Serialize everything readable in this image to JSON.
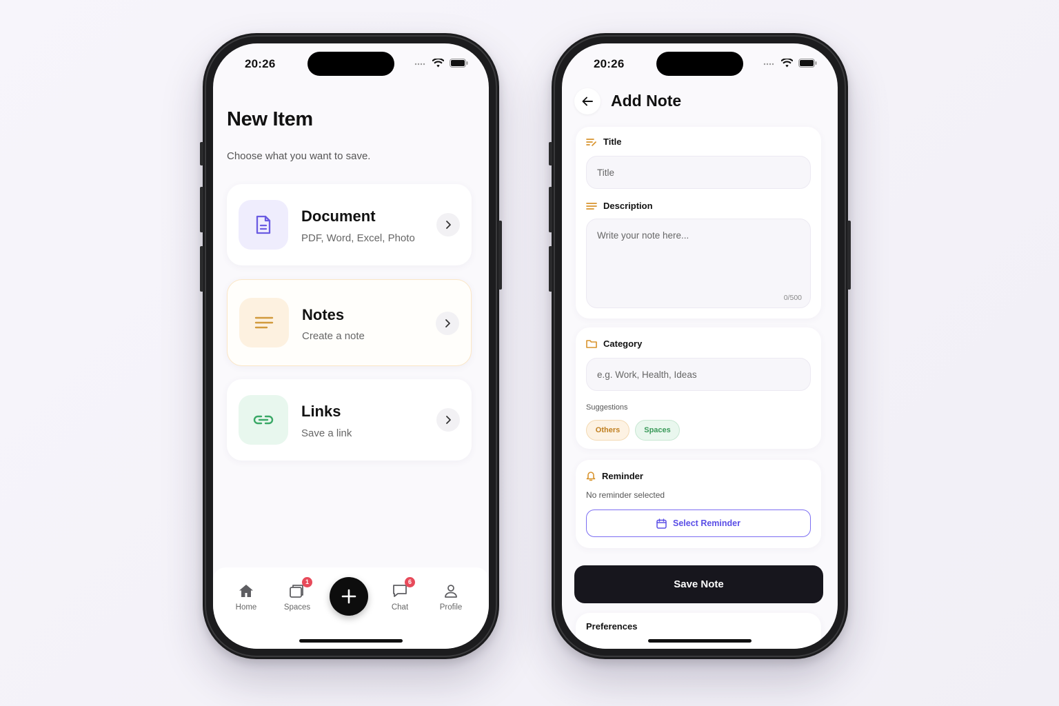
{
  "left_phone": {
    "status": {
      "time": "20:26"
    },
    "title": "New Item",
    "subtitle": "Choose what you want to save.",
    "options": [
      {
        "title": "Document",
        "desc": "PDF, Word, Excel, Photo",
        "icon": "document-icon",
        "accent": "#6a5be2",
        "bg": "#efedfd"
      },
      {
        "title": "Notes",
        "desc": "Create a note",
        "icon": "notes-lines-icon",
        "accent": "#d19a3c",
        "bg": "#fdf1e0"
      },
      {
        "title": "Links",
        "desc": "Save a link",
        "icon": "link-icon",
        "accent": "#3aa866",
        "bg": "#e8f7ee"
      }
    ],
    "tabbar": {
      "home": "Home",
      "spaces": "Spaces",
      "spaces_badge": "1",
      "chat": "Chat",
      "chat_badge": "6",
      "profile": "Profile"
    }
  },
  "right_phone": {
    "status": {
      "time": "20:26"
    },
    "title": "Add Note",
    "title_field": {
      "label": "Title",
      "placeholder": "Title"
    },
    "description_field": {
      "label": "Description",
      "placeholder": "Write your note here...",
      "counter": "0/500"
    },
    "category": {
      "label": "Category",
      "placeholder": "e.g. Work, Health, Ideas",
      "suggestions_label": "Suggestions",
      "suggestions": [
        "Others",
        "Spaces"
      ]
    },
    "reminder": {
      "label": "Reminder",
      "status": "No reminder selected",
      "button": "Select Reminder"
    },
    "save_button": "Save Note",
    "preferences_label": "Preferences"
  },
  "colors": {
    "accent_orange": "#d8932c",
    "accent_purple": "#5a4ee6",
    "dark": "#17161d"
  }
}
